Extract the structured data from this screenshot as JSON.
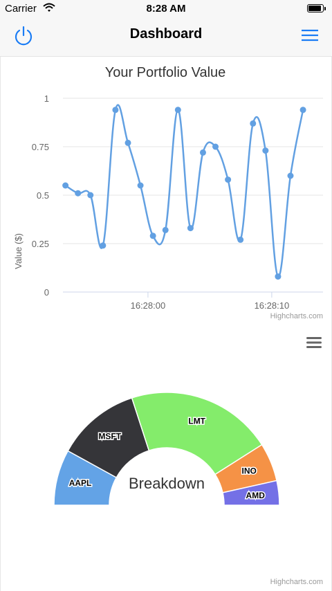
{
  "status_bar": {
    "carrier": "Carrier",
    "time": "8:28 AM",
    "battery_level": 0.9
  },
  "nav": {
    "title": "Dashboard",
    "left_icon": "power-icon",
    "right_icon": "hamburger-menu-icon",
    "accent_color": "#1a7cf5"
  },
  "credits": {
    "line": "Highcharts.com",
    "pie": "Highcharts.com"
  },
  "chart_data": [
    {
      "type": "line",
      "title": "Your Portfolio Value",
      "ylabel": "Value ($)",
      "ylim": [
        0,
        1
      ],
      "yticks": [
        "0",
        "0.25",
        "0.5",
        "0.75",
        "1"
      ],
      "xtick_labels": [
        "16:28:00",
        "16:28:10"
      ],
      "xlim": [
        -0.2,
        20.6
      ],
      "xtick_positions": [
        6.6,
        16.5
      ],
      "grid": true,
      "smooth": true,
      "color": "#62a0e2",
      "values": [
        0.55,
        0.51,
        0.5,
        0.24,
        0.94,
        0.77,
        0.55,
        0.29,
        0.32,
        0.94,
        0.33,
        0.72,
        0.75,
        0.58,
        0.27,
        0.87,
        0.73,
        0.08,
        0.6,
        0.94
      ]
    },
    {
      "type": "pie",
      "subtype": "semi-donut",
      "center_label": "Breakdown",
      "slices": [
        {
          "label": "AAPL",
          "value": 16,
          "color": "#63a3e6"
        },
        {
          "label": "MSFT",
          "value": 24,
          "color": "#353539"
        },
        {
          "label": "LMT",
          "value": 42,
          "color": "#84ec6b"
        },
        {
          "label": "INO",
          "value": 11,
          "color": "#f59246"
        },
        {
          "label": "AMD",
          "value": 7,
          "color": "#7470e6"
        }
      ]
    }
  ],
  "context_menu_icon": "context-menu-icon"
}
